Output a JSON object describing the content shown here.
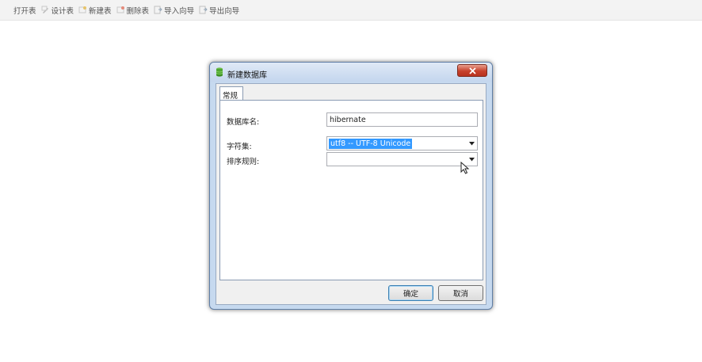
{
  "toolbar": {
    "items": [
      {
        "label": "打开表",
        "icon": "open-table-icon"
      },
      {
        "label": "设计表",
        "icon": "design-table-icon"
      },
      {
        "label": "新建表",
        "icon": "new-table-icon"
      },
      {
        "label": "删除表",
        "icon": "delete-table-icon"
      },
      {
        "label": "导入向导",
        "icon": "import-wizard-icon"
      },
      {
        "label": "导出向导",
        "icon": "export-wizard-icon"
      }
    ]
  },
  "dialog": {
    "title": "新建数据库",
    "tab_label": "常规",
    "db_name_label": "数据库名:",
    "db_name_value": "hibernate",
    "charset_label": "字符集:",
    "charset_value": "utf8 -- UTF-8 Unicode",
    "collation_label": "排序规则:",
    "collation_value": "",
    "ok_label": "确定",
    "cancel_label": "取消"
  },
  "colors": {
    "selection": "#3399ff",
    "close_button": "#c7412c",
    "dialog_frame": "#c6d9ef"
  }
}
